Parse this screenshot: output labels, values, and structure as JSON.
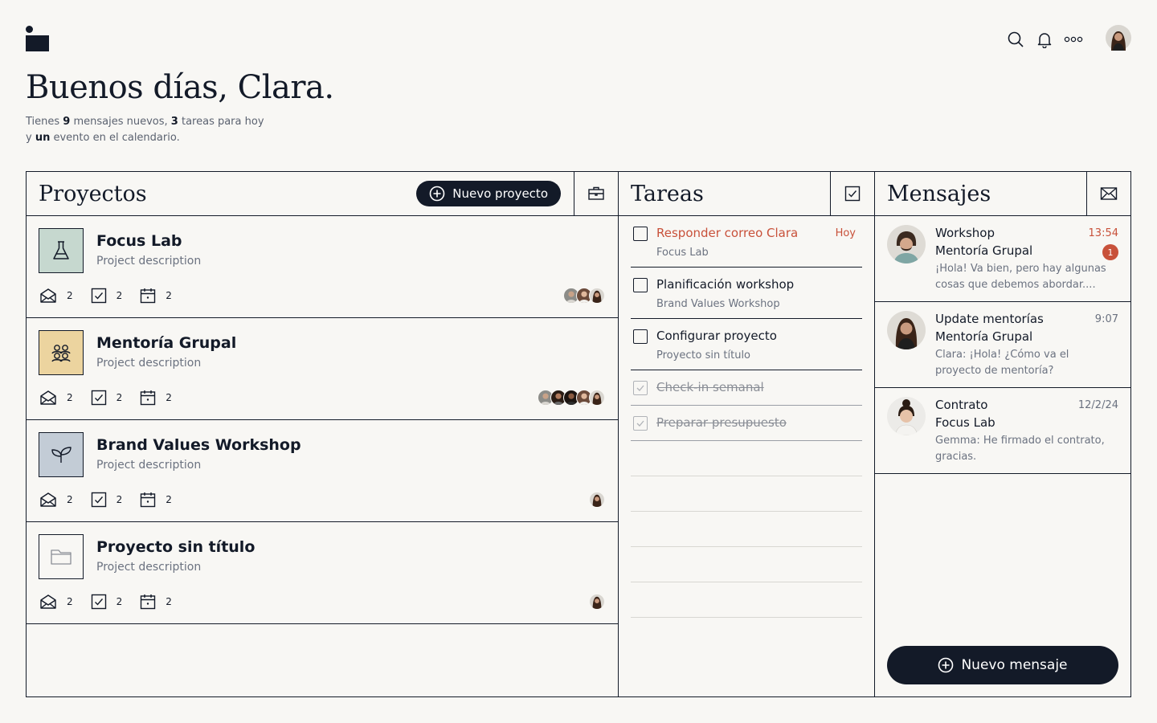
{
  "header": {
    "greeting": "Buenos días, Clara.",
    "subtitle": {
      "p1": "Tienes ",
      "new_messages": "9",
      "p2": " mensajes nuevos, ",
      "tasks_today": "3",
      "p3": " tareas para hoy",
      "p4": "y ",
      "events": "un",
      "p5": " evento en el calendario."
    },
    "icons": [
      "search-icon",
      "bell-icon",
      "more-icon",
      "avatar"
    ]
  },
  "projects": {
    "title": "Proyectos",
    "new_button": "Nuevo proyecto",
    "items": [
      {
        "name": "Focus Lab",
        "description": "Project description",
        "thumb_color": "#c6d8cf",
        "icon": "flask-icon",
        "messages": "2",
        "tasks": "2",
        "events": "2"
      },
      {
        "name": "Mentoría Grupal",
        "description": "Project description",
        "thumb_color": "#ecd49f",
        "icon": "group-icon",
        "messages": "2",
        "tasks": "2",
        "events": "2"
      },
      {
        "name": "Brand Values Workshop",
        "description": "Project description",
        "thumb_color": "#c3ccd6",
        "icon": "leaf-icon",
        "messages": "2",
        "tasks": "2",
        "events": "2"
      },
      {
        "name": "Proyecto sin título",
        "description": "Project description",
        "thumb_color": "#f8f7f4",
        "icon": "folder-icon",
        "messages": "2",
        "tasks": "2",
        "events": "2"
      }
    ]
  },
  "tasks": {
    "title": "Tareas",
    "items": [
      {
        "name": "Responder correo Clara",
        "project": "Focus Lab",
        "due": "Hoy"
      },
      {
        "name": "Planificación workshop",
        "project": "Brand Values Workshop"
      },
      {
        "name": "Configurar proyecto",
        "project": "Proyecto sin título"
      },
      {
        "name": "Check-in semanal"
      },
      {
        "name": "Preparar presupuesto"
      }
    ]
  },
  "messages": {
    "title": "Mensajes",
    "new_button": "Nuevo mensaje",
    "items": [
      {
        "subject": "Workshop",
        "project": "Mentoría Grupal",
        "preview": "¡Hola! Va bien, pero hay algunas cosas que debemos abordar....",
        "time": "13:54",
        "unread": "1"
      },
      {
        "subject": "Update mentorías",
        "project": "Mentoría Grupal",
        "preview": "Clara: ¡Hola! ¿Cómo va el proyecto de mentoría?",
        "time": "9:07"
      },
      {
        "subject": "Contrato",
        "project": "Focus Lab",
        "preview": "Gemma: He firmado el contrato, gracias.",
        "time": "12/2/24"
      }
    ]
  },
  "colors": {
    "ink": "#131a28",
    "accent": "#c8513a",
    "background": "#f8f7f4"
  }
}
